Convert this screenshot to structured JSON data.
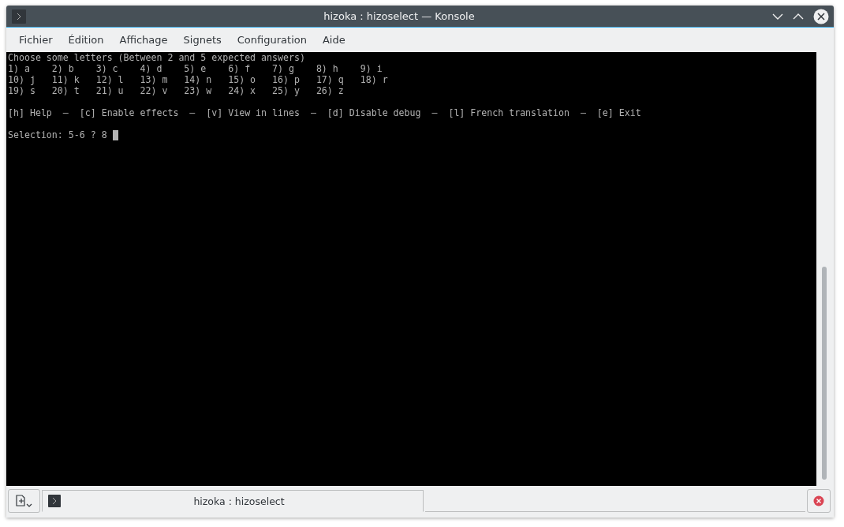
{
  "window": {
    "title": "hizoka : hizoselect — Konsole"
  },
  "menu": [
    "Fichier",
    "Édition",
    "Affichage",
    "Signets",
    "Configuration",
    "Aide"
  ],
  "terminal": {
    "blocks": [
      [
        "Choose some letters (Between 2 and 5 expected answers)",
        "1) a    2) b    3) c    4) d    5) e    6) f    7) g    8) h    9) i",
        "10) j   11) k   12) l   13) m   14) n   15) o   16) p   17) q   18) r",
        "19) s   20) t   21) u   22) v   23) w   24) x   25) y   26) z"
      ],
      [
        "[h] Help  –  [c] Enable effects  –  [v] View in lines  –  [d] Disable debug  –  [l] French translation  –  [e] Exit"
      ]
    ],
    "prompt": {
      "text": "Selection: 5-6 ? 8",
      "cursor": true
    }
  },
  "tabs": [
    {
      "label": "hizoka : hizoselect",
      "selected": true
    }
  ]
}
